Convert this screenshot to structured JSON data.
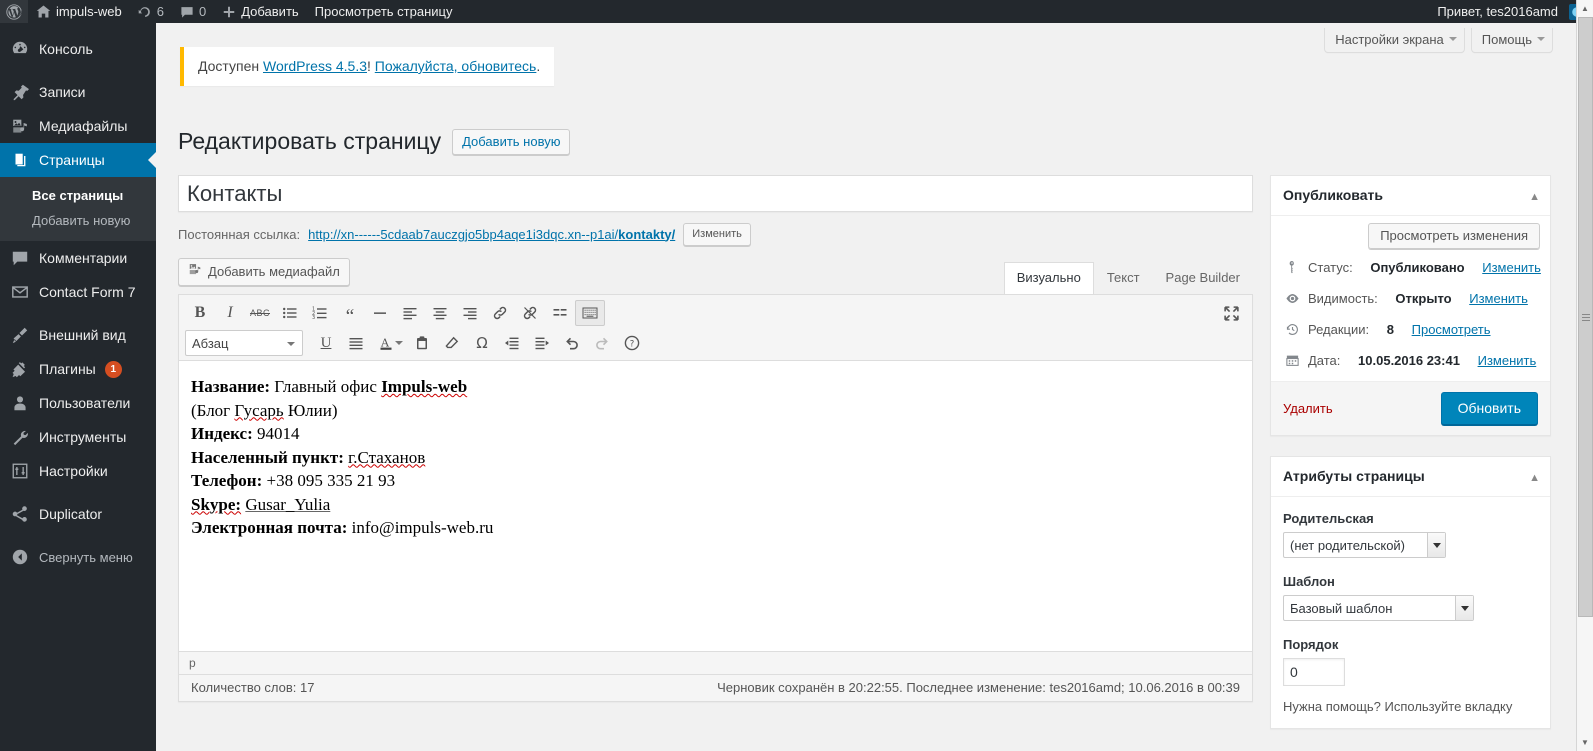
{
  "adminbar": {
    "logo_icon": "wordpress-logo-icon",
    "site_name": "impuls-web",
    "home_icon": "home-icon",
    "updates_icon": "updates-icon",
    "updates_count": "6",
    "comments_icon": "comment-bubble-icon",
    "comments_count": "0",
    "new_icon": "plus-icon",
    "new_label": "Добавить",
    "view_page_label": "Просмотреть страницу",
    "howdy": "Привет, tes2016amd",
    "avatar_icon": "user-avatar-icon"
  },
  "sidebar": {
    "items": [
      {
        "label": "Консоль",
        "icon": "dashboard-icon",
        "current": false
      },
      {
        "label": "Записи",
        "icon": "pin-icon",
        "current": false
      },
      {
        "label": "Медиафайлы",
        "icon": "media-icon",
        "current": false
      },
      {
        "label": "Страницы",
        "icon": "pages-icon",
        "current": true
      },
      {
        "label": "Комментарии",
        "icon": "comment-bubble-icon",
        "current": false
      },
      {
        "label": "Contact Form 7",
        "icon": "envelope-icon",
        "current": false
      },
      {
        "label": "Внешний вид",
        "icon": "appearance-brush-icon",
        "current": false
      },
      {
        "label": "Плагины",
        "icon": "plugin-icon",
        "current": false,
        "badge": "1"
      },
      {
        "label": "Пользователи",
        "icon": "users-icon",
        "current": false
      },
      {
        "label": "Инструменты",
        "icon": "tools-wrench-icon",
        "current": false
      },
      {
        "label": "Настройки",
        "icon": "settings-sliders-icon",
        "current": false
      },
      {
        "label": "Duplicator",
        "icon": "share-nodes-icon",
        "current": false
      }
    ],
    "submenu": [
      {
        "label": "Все страницы",
        "current": true
      },
      {
        "label": "Добавить новую",
        "current": false
      }
    ],
    "collapse": {
      "label": "Свернуть меню",
      "icon": "collapse-arrow-icon"
    }
  },
  "screen_meta": {
    "screen_options": "Настройки экрана",
    "help": "Помощь"
  },
  "notice": {
    "prefix": "Доступен ",
    "link_version": "WordPress 4.5.3",
    "exclaim": "! ",
    "link_update": "Пожалуйста, обновитесь",
    "suffix": "."
  },
  "page": {
    "title": "Редактировать страницу",
    "add_new_label": "Добавить новую"
  },
  "editor": {
    "post_title": "Контакты",
    "post_title_placeholder": "Введите заголовок",
    "permalink_label": "Постоянная ссылка:",
    "permalink_base": "http://xn------5cdaab7auczgjo5bp4aqe1i3dqc.xn--p1ai/",
    "permalink_slug": "kontakty/",
    "edit_slug_button": "Изменить",
    "add_media_label": "Добавить медиафайл",
    "add_media_icon": "media-icon",
    "tabs": [
      {
        "label": "Визуально",
        "active": true
      },
      {
        "label": "Текст",
        "active": false
      },
      {
        "label": "Page Builder",
        "active": false
      }
    ],
    "toolbar_row1": [
      {
        "icon": "bold-icon",
        "glyph": "B"
      },
      {
        "icon": "italic-icon",
        "glyph": "I"
      },
      {
        "icon": "strikethrough-icon",
        "glyph": "ABC"
      },
      {
        "icon": "bulleted-list-icon",
        "glyph": ""
      },
      {
        "icon": "numbered-list-icon",
        "glyph": ""
      },
      {
        "icon": "blockquote-icon",
        "glyph": "“"
      },
      {
        "icon": "horizontal-rule-icon",
        "glyph": "—"
      },
      {
        "icon": "align-left-icon",
        "glyph": ""
      },
      {
        "icon": "align-center-icon",
        "glyph": ""
      },
      {
        "icon": "align-right-icon",
        "glyph": ""
      },
      {
        "icon": "insert-link-icon",
        "glyph": ""
      },
      {
        "icon": "remove-link-icon",
        "glyph": ""
      },
      {
        "icon": "read-more-tag-icon",
        "glyph": ""
      },
      {
        "icon": "toggle-toolbar-icon",
        "glyph": ""
      }
    ],
    "toolbar_row2": [
      {
        "icon": "underline-icon",
        "glyph": "U"
      },
      {
        "icon": "justify-icon",
        "glyph": ""
      },
      {
        "icon": "text-color-icon",
        "glyph": "A"
      },
      {
        "icon": "paste-as-text-icon",
        "glyph": ""
      },
      {
        "icon": "clear-formatting-icon",
        "glyph": ""
      },
      {
        "icon": "special-character-icon",
        "glyph": "Ω"
      },
      {
        "icon": "outdent-icon",
        "glyph": ""
      },
      {
        "icon": "indent-icon",
        "glyph": ""
      },
      {
        "icon": "undo-icon",
        "glyph": ""
      },
      {
        "icon": "redo-icon",
        "glyph": ""
      },
      {
        "icon": "keyboard-shortcuts-help-icon",
        "glyph": "?"
      }
    ],
    "style_select": "Абзац",
    "fullscreen_icon": "fullscreen-expand-icon",
    "content_lines": [
      {
        "bold": "Название:",
        "rest": " Главный офис ",
        "strong_spell": "Impuls-web"
      },
      {
        "plain_prefix": "(Блог ",
        "spell": "Гусарь",
        "plain_suffix": " Юлии)"
      },
      {
        "bold": "Индекс:",
        "rest": " 94014"
      },
      {
        "bold": "Населенный пункт:",
        "rest": " ",
        "spell_tail": "г.Стаханов"
      },
      {
        "bold": "Телефон:",
        "rest": " +38 095 335 21 93"
      },
      {
        "bold_spell": "Skype:",
        "rest": " ",
        "spell_tail": "Gusar_Yulia"
      },
      {
        "bold": "Электронная почта:",
        "rest": " info@impuls-web.ru"
      }
    ],
    "statusbar_path": "p",
    "word_count": "Количество слов: 17",
    "autosave_notice": "Черновик сохранён в 20:22:55. Последнее изменение: tes2016amd; 10.06.2016 в 00:39"
  },
  "publish_box": {
    "title": "Опубликовать",
    "toggle_icon": "chevron-up-icon",
    "preview_button": "Просмотреть изменения",
    "status_icon": "post-status-key-icon",
    "status_label": "Статус:",
    "status_value": "Опубликовано",
    "status_edit": "Изменить",
    "visibility_icon": "eye-icon",
    "visibility_label": "Видимость:",
    "visibility_value": "Открыто",
    "visibility_edit": "Изменить",
    "revisions_icon": "backup-clock-icon",
    "revisions_label": "Редакции:",
    "revisions_value": "8",
    "revisions_browse": "Просмотреть",
    "date_icon": "calendar-icon",
    "date_label": "Дата:",
    "date_value": "10.05.2016 23:41",
    "date_edit": "Изменить",
    "delete_label": "Удалить",
    "update_label": "Обновить"
  },
  "attributes_box": {
    "title": "Атрибуты страницы",
    "toggle_icon": "chevron-up-icon",
    "parent_label": "Родительская",
    "parent_value": "(нет родительской)",
    "template_label": "Шаблон",
    "template_value": "Базовый шаблон",
    "order_label": "Порядок",
    "order_value": "0",
    "help_text": "Нужна помощь? Используйте вкладку"
  },
  "scrollbar": {
    "up_icon": "scroll-up-arrow-icon",
    "down_icon": "scroll-down-arrow-icon"
  },
  "colors": {
    "admin_bg": "#23282d",
    "accent": "#0073aa",
    "primary_button": "#0085ba",
    "notice_border": "#ffb900",
    "badge": "#d54e21",
    "delete_link": "#a00"
  }
}
